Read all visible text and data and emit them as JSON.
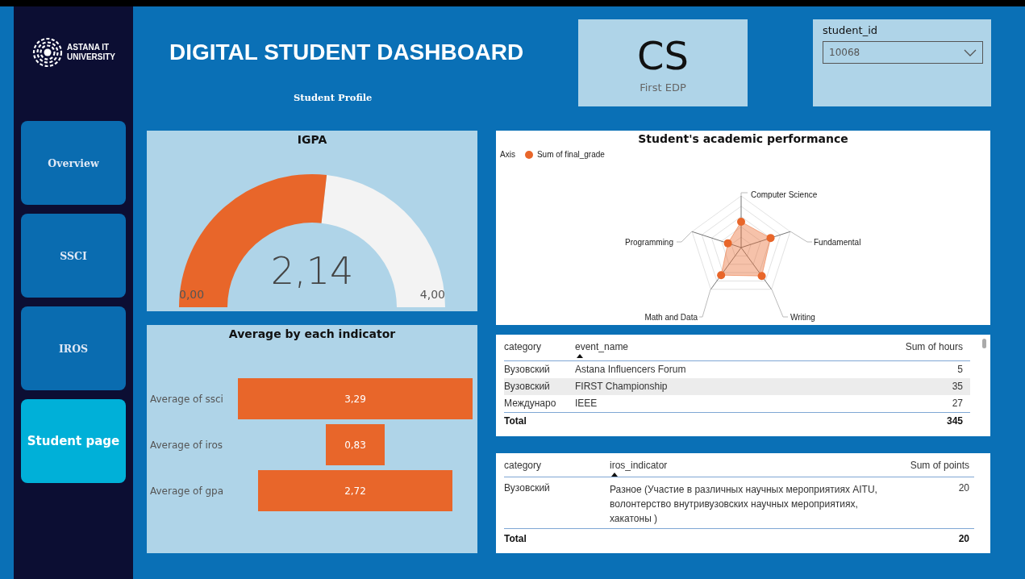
{
  "sidebar": {
    "logo_text": [
      "ASTANA IT",
      "UNIVERSITY"
    ],
    "items": [
      {
        "label": "Overview",
        "selected": false
      },
      {
        "label": "SSCI",
        "selected": false
      },
      {
        "label": "IROS",
        "selected": false
      },
      {
        "label": "Student page",
        "selected": true
      }
    ]
  },
  "header": {
    "title": "DIGITAL STUDENT DASHBOARD",
    "subtitle": "Student Profile"
  },
  "program_card": {
    "value": "CS",
    "label": "First EDP"
  },
  "slicer": {
    "label": "student_id",
    "value": "10068"
  },
  "gauge": {
    "title": "IGPA",
    "value": "2,14",
    "min": "0,00",
    "max": "4,00"
  },
  "radar": {
    "title": "Student's academic performance",
    "legend_title": "Axis",
    "series_name": "Sum of final_grade",
    "axes": [
      "Computer Science",
      "Fundamental",
      "Writing",
      "Math and Data",
      "Programming"
    ]
  },
  "averages": {
    "title": "Average by each indicator",
    "items": [
      {
        "label": "Average of ssci",
        "value": "3,29"
      },
      {
        "label": "Average of iros",
        "value": "0,83"
      },
      {
        "label": "Average of gpa",
        "value": "2,72"
      }
    ]
  },
  "events_table": {
    "columns": [
      "category",
      "event_name",
      "Sum of hours"
    ],
    "rows": [
      {
        "cells": [
          "Вузовский",
          "Astana Influencers Forum",
          "5"
        ],
        "selected": false
      },
      {
        "cells": [
          "Вузовский",
          "FIRST Championship",
          "35"
        ],
        "selected": true
      },
      {
        "cells": [
          "Междунаро",
          "IEEE",
          "27"
        ],
        "selected": false
      }
    ],
    "total": [
      "Total",
      "345"
    ]
  },
  "iros_table": {
    "columns": [
      "category",
      "iros_indicator",
      "Sum of points"
    ],
    "rows": [
      {
        "cells": [
          "Вузовский",
          "Разное (Участие в различных научных мероприятиях AITU, волонтерство внутривузовских научных мероприятиях, хакатоны )",
          "20"
        ],
        "selected": false
      }
    ],
    "total": [
      "Total",
      "20"
    ]
  }
}
